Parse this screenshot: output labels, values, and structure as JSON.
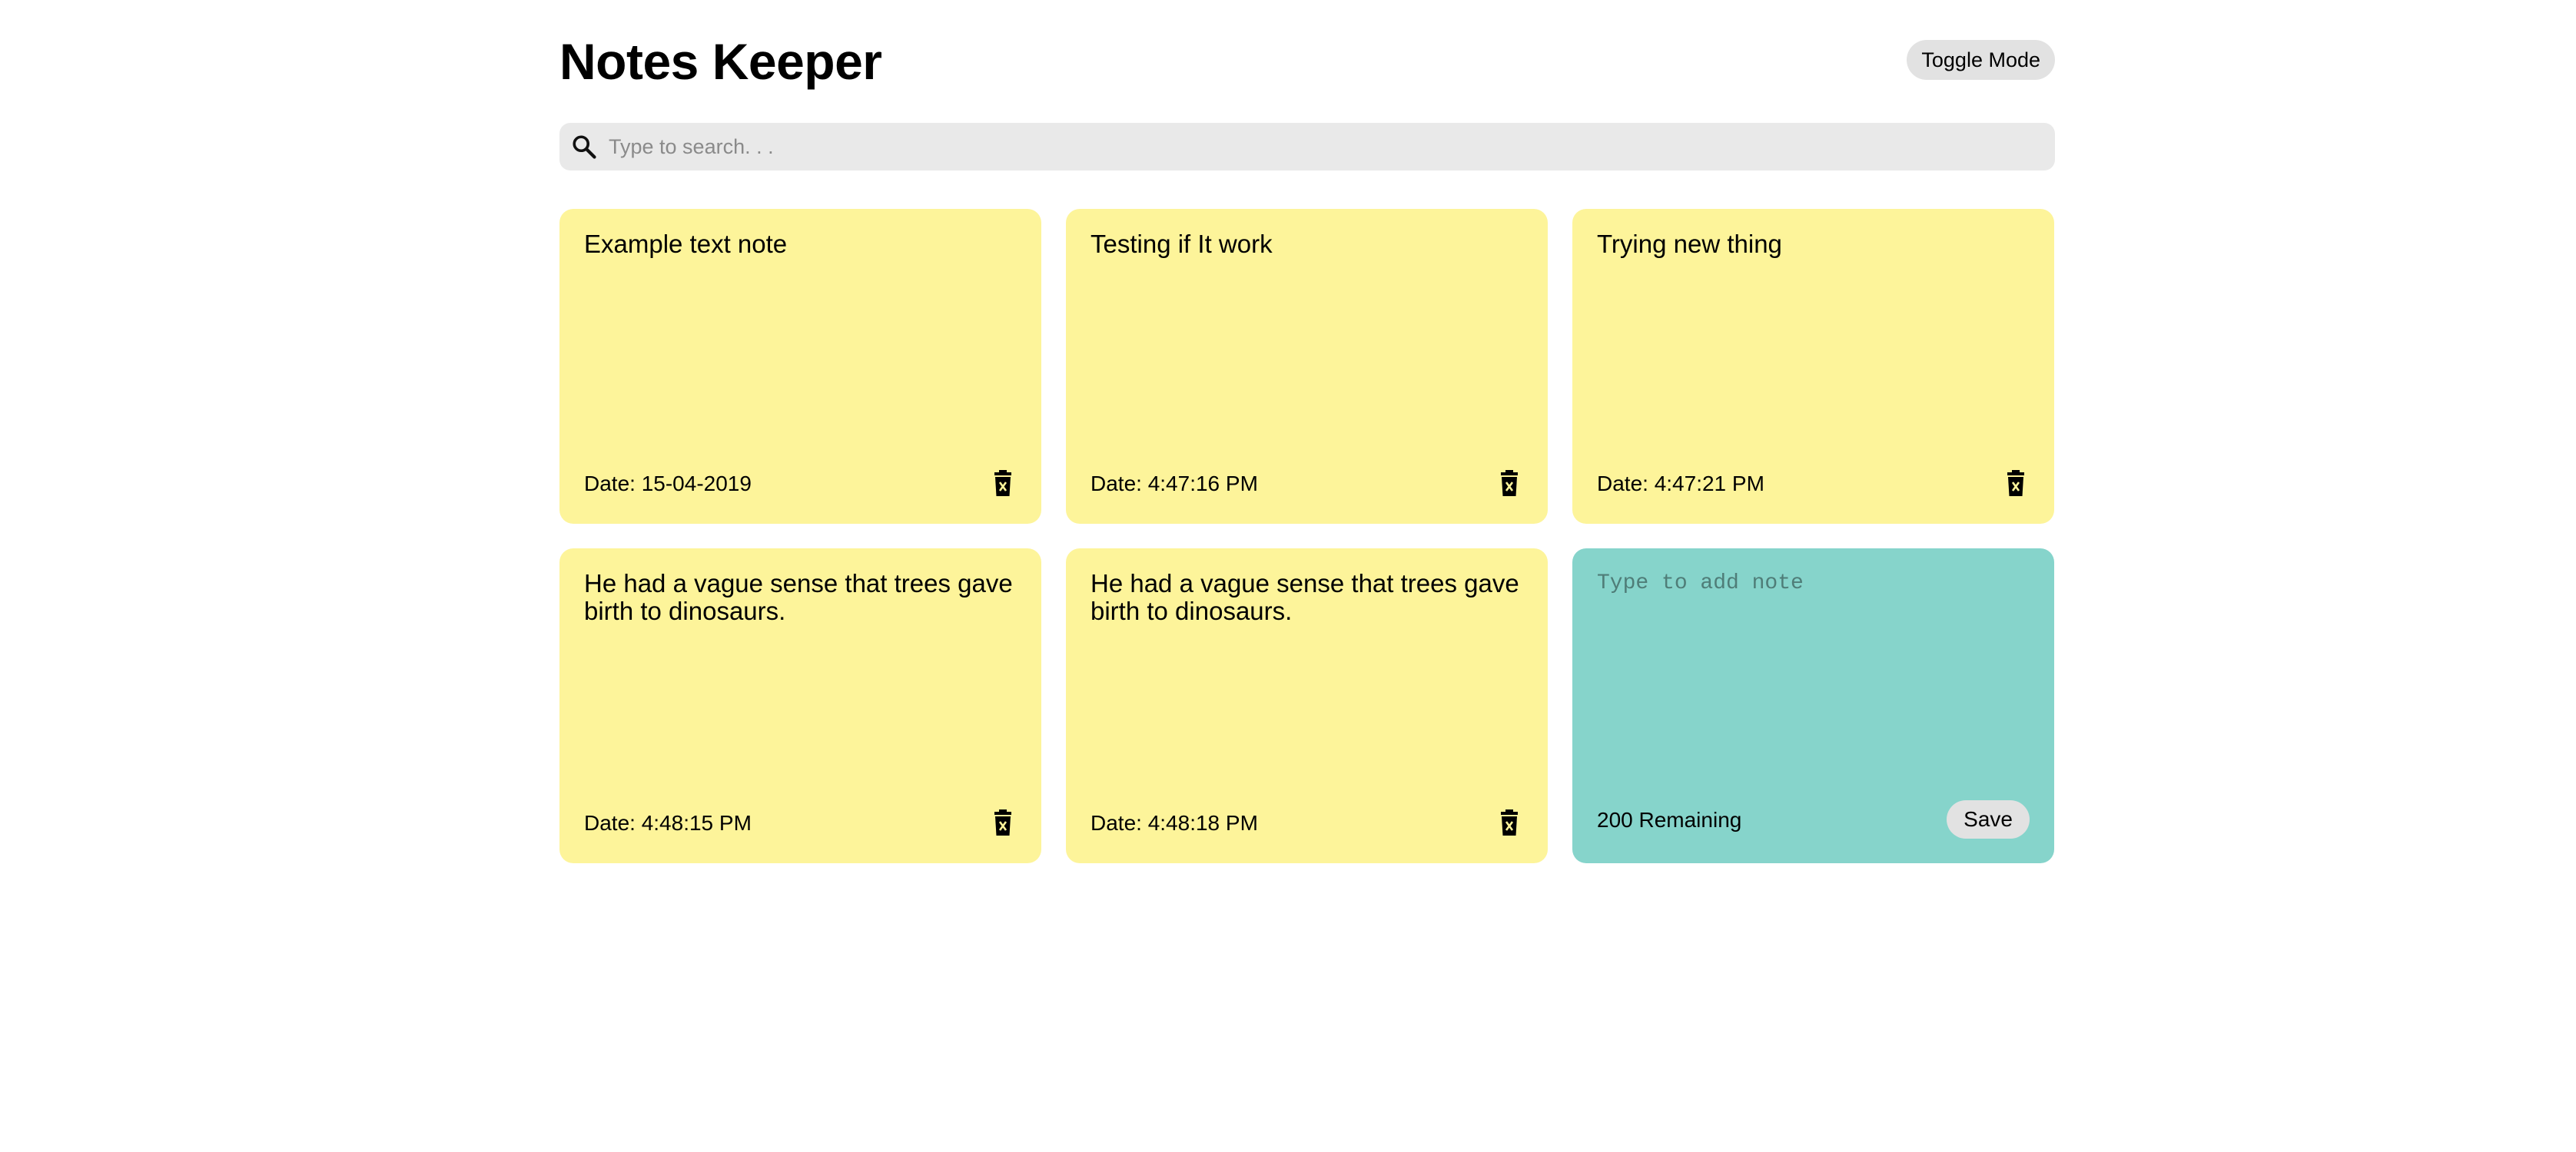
{
  "header": {
    "title": "Notes Keeper",
    "toggle_label": "Toggle Mode"
  },
  "search": {
    "placeholder": "Type to search. . .",
    "value": "",
    "icon": "search-icon"
  },
  "notes": [
    {
      "text": "Example text note",
      "date": "Date: 15-04-2019",
      "delete_icon": "trash-icon"
    },
    {
      "text": "Testing if It work",
      "date": "Date: 4:47:16 PM",
      "delete_icon": "trash-icon"
    },
    {
      "text": "Trying new thing",
      "date": "Date: 4:47:21 PM",
      "delete_icon": "trash-icon"
    },
    {
      "text": "He had a vague sense that trees gave birth to dinosaurs.",
      "date": "Date: 4:48:15 PM",
      "delete_icon": "trash-icon"
    },
    {
      "text": "He had a vague sense that trees gave birth to dinosaurs.",
      "date": "Date: 4:48:18 PM",
      "delete_icon": "trash-icon"
    }
  ],
  "add_note": {
    "placeholder": "Type to add note",
    "value": "",
    "remaining": "200 Remaining",
    "save_label": "Save"
  },
  "colors": {
    "note_bg": "#fdf49a",
    "add_note_bg": "#86d4cb",
    "search_bg": "#e9e9e9",
    "button_bg": "#e2e2e2"
  }
}
